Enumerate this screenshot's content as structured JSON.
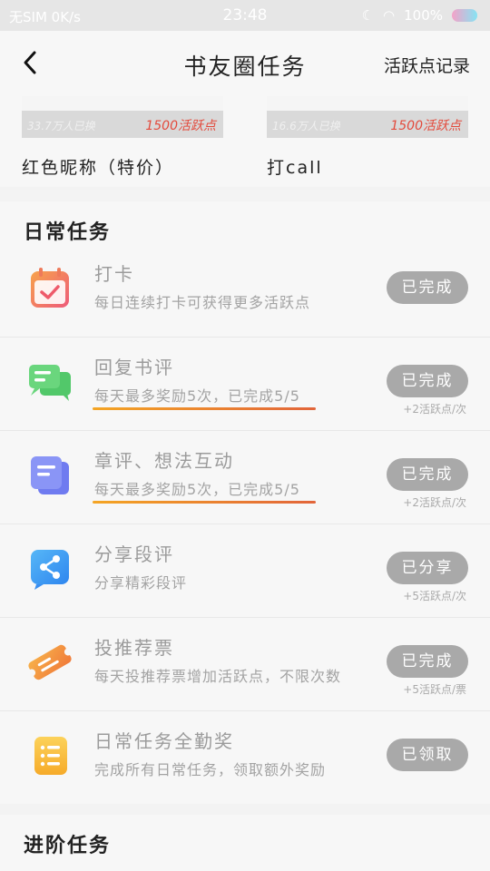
{
  "status_bar": {
    "carrier": "无SIM 0K/s",
    "time": "23:48",
    "battery": "100%"
  },
  "header": {
    "title": "书友圈任务",
    "record_link": "活跃点记录"
  },
  "rewards": [
    {
      "count_text": "33.7万人已换",
      "points": "1500活跃点",
      "name": "红色昵称（特价）"
    },
    {
      "count_text": "16.6万人已换",
      "points": "1500活跃点",
      "name": "打call"
    }
  ],
  "daily": {
    "title": "日常任务",
    "tasks": [
      {
        "name": "打卡",
        "desc": "每日连续打卡可获得更多活跃点",
        "button": "已完成",
        "sub": "",
        "icon": "calendar-check-icon"
      },
      {
        "name": "回复书评",
        "desc": "每天最多奖励5次，已完成5/5",
        "button": "已完成",
        "sub": "+2活跃点/次",
        "icon": "chat-bubbles-icon",
        "progress": 1.0
      },
      {
        "name": "章评、想法互动",
        "desc": "每天最多奖励5次，已完成5/5",
        "button": "已完成",
        "sub": "+2活跃点/次",
        "icon": "note-cards-icon",
        "progress": 1.0
      },
      {
        "name": "分享段评",
        "desc": "分享精彩段评",
        "button": "已分享",
        "sub": "+5活跃点/次",
        "icon": "share-icon"
      },
      {
        "name": "投推荐票",
        "desc": "每天投推荐票增加活跃点，不限次数",
        "button": "已完成",
        "sub": "+5活跃点/票",
        "icon": "ticket-icon"
      },
      {
        "name": "日常任务全勤奖",
        "desc": "完成所有日常任务，领取额外奖励",
        "button": "已领取",
        "sub": "",
        "icon": "list-icon"
      }
    ]
  },
  "advanced": {
    "title": "进阶任务"
  },
  "colors": {
    "accent_red": "#e34a3c",
    "progress_start": "#f4a524",
    "progress_end": "#e2653a",
    "button_gray": "#a9a9a9"
  }
}
